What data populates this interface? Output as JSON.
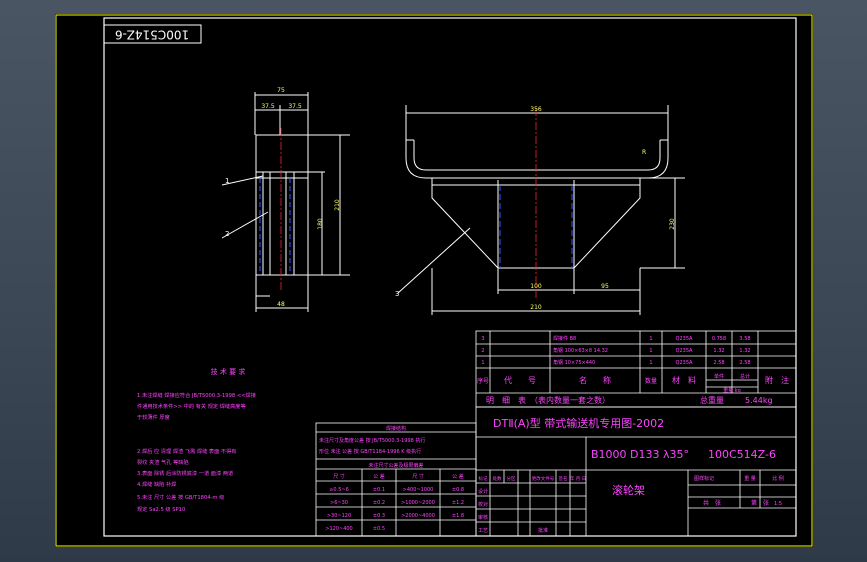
{
  "drawing_number": "100C514Z-6",
  "technical_requirements": {
    "title": "技 术 要 求",
    "lines": [
      "1.未注焊缝 焊接应符合 JB/T5000.3-1998 <<焊接",
      "件通用技术条件>> 中的 有关 规定 焊缝高度等",
      "于较薄件 厚度",
      "2.焊后 应 清理 焊渣 飞溅 焊缝 表面 不得有",
      "裂纹 夹渣 气孔 等缺陷",
      "3.表面 除锈 后涂防锈底漆 一道 面漆 两道",
      "4.焊缝 缺陷 补焊",
      "5.未注 尺寸 公差 按 GB/T1804-m 级",
      "规定 Sa2.5 级 SP10"
    ]
  },
  "tolerance_table": {
    "title": "焊接结构",
    "lines": [
      "未注尺寸及角度公差 按 JB/T5000.3-1998 执行",
      "形位 未注 公差 按 GB/T1184-1996 K 级执行"
    ],
    "subtitle": "未注尺寸公差及极限偏差",
    "headers": [
      "尺 寸",
      "公 差",
      "尺 寸",
      "公 差"
    ],
    "rows": [
      [
        "≥0.5~6",
        "±0.1",
        ">400~1000",
        "±0.8"
      ],
      [
        ">6~30",
        "±0.2",
        ">1000~2000",
        "±1.2"
      ],
      [
        ">30~120",
        "±0.3",
        ">2000~4000",
        "±1.8"
      ],
      [
        ">120~400",
        "±0.5",
        "",
        ""
      ]
    ]
  },
  "bom": {
    "rows": [
      {
        "no": "3",
        "code": "",
        "name": "焊接件 B8",
        "qty": "1",
        "material": "Q235A",
        "unit_wt": "0.758",
        "total_wt": "3.58"
      },
      {
        "no": "2",
        "code": "",
        "name": "角钢 100×63×8 14.32",
        "qty": "1",
        "material": "Q235A",
        "unit_wt": "1.32",
        "total_wt": "1.32"
      },
      {
        "no": "1",
        "code": "",
        "name": "角钢 10×75×440",
        "qty": "1",
        "material": "Q235A",
        "unit_wt": "2.58",
        "total_wt": "2.58"
      }
    ],
    "headers": {
      "no": "序号",
      "code": "代　　号",
      "name": "名　　称",
      "qty": "数量",
      "material": "材　料",
      "unit_wt": "单件",
      "total_wt": "总计",
      "weight": "重量 kg",
      "remark": "附　注"
    },
    "detail_line": "明　细　表　（表内数量一套之数）",
    "total_label": "总重量",
    "total_value": "5.44kg"
  },
  "title_block": {
    "series": "DTⅡ(A)型 带式输送机专用图-2002",
    "model": "B1000 D133 λ35°",
    "drawing_code": "100C514Z-6",
    "part_name": "滚轮架",
    "stage_label": "图样标记",
    "weight_label": "重 量",
    "scale_label": "比 例",
    "scale_value": "1:5",
    "sheet_label": "共　张",
    "sheet_of_label": "第　张",
    "rev_headers": [
      "标记",
      "处数",
      "分区",
      "更改文件号",
      "签名",
      "年 月 日"
    ],
    "roles": [
      "设计",
      "",
      "校对",
      "审核",
      "工艺",
      "批准"
    ]
  },
  "dimensions": {
    "side_view": [
      "75",
      "37.5",
      "37.5",
      "180",
      "210",
      "48"
    ],
    "front_view": [
      "356",
      "210",
      "100",
      "95",
      "230",
      "R"
    ]
  },
  "balloons": [
    "1",
    "2",
    "3"
  ]
}
